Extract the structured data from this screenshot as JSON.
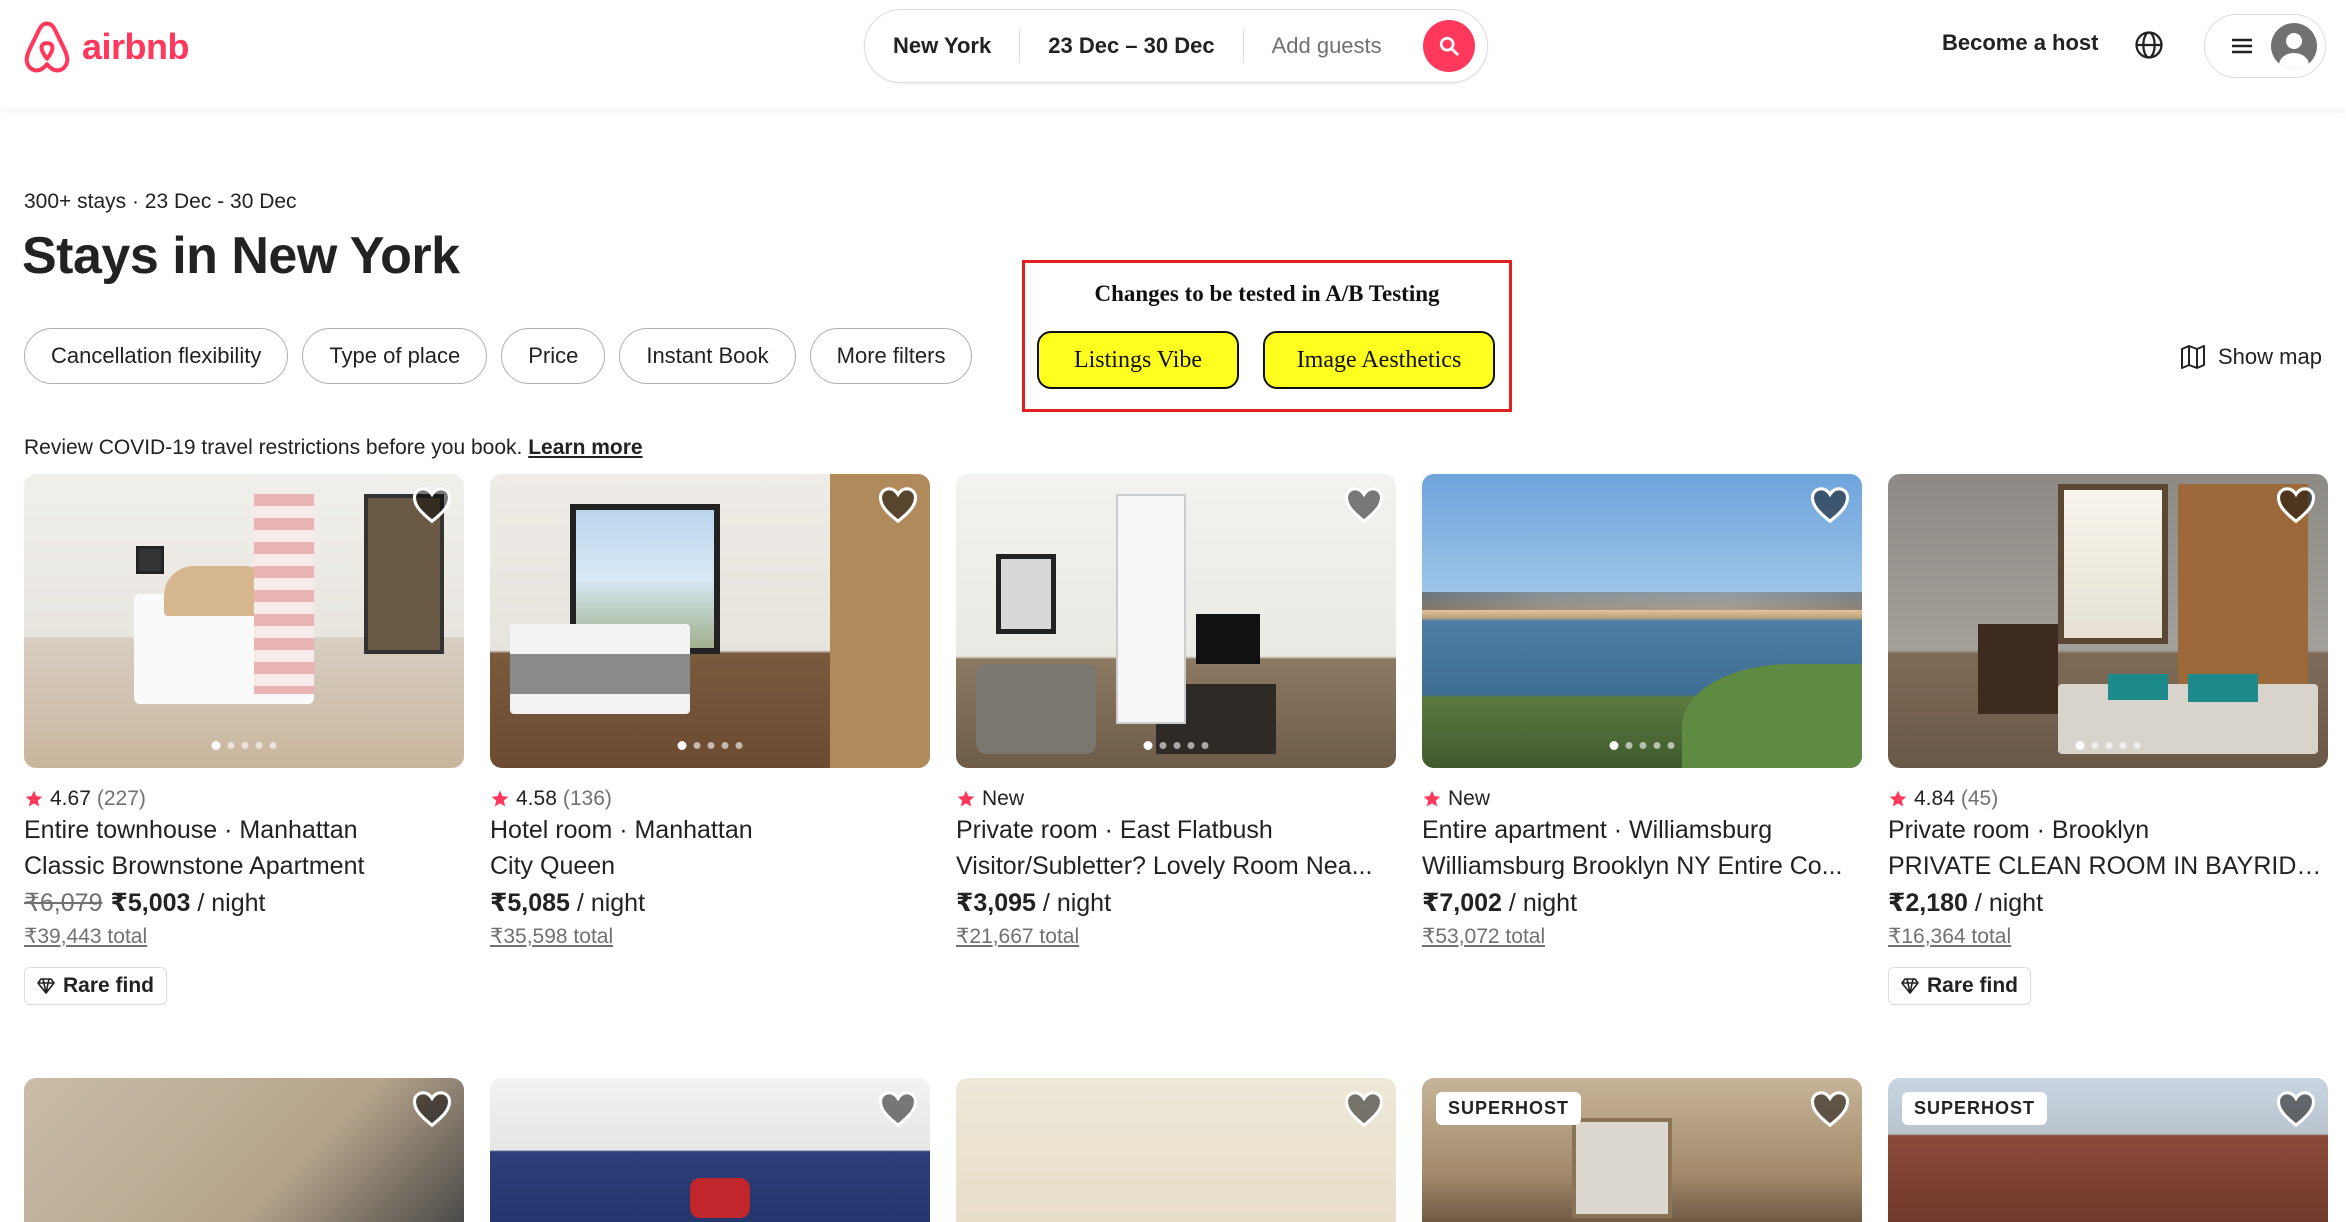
{
  "header": {
    "logo_text": "airbnb",
    "search": {
      "location": "New York",
      "dates": "23 Dec – 30 Dec",
      "guests_placeholder": "Add guests"
    },
    "become_host": "Become a host"
  },
  "page": {
    "meta": "300+ stays · 23 Dec - 30 Dec",
    "title": "Stays in New York"
  },
  "filters": [
    "Cancellation flexibility",
    "Type of place",
    "Price",
    "Instant Book",
    "More filters"
  ],
  "ab_test": {
    "title": "Changes to be tested in A/B Testing",
    "buttons": [
      "Listings Vibe",
      "Image Aesthetics"
    ]
  },
  "show_map": "Show map",
  "covid": {
    "text": "Review COVID-19 travel restrictions before you book.",
    "link": "Learn more"
  },
  "listings": [
    {
      "rating": "4.67",
      "count": "(227)",
      "type": "Entire townhouse · Manhattan",
      "name": "Classic Brownstone Apartment",
      "old_price": "₹6,079",
      "price": "₹5,003",
      "per": "/ night",
      "total": "₹39,443 total",
      "badge": "Rare find"
    },
    {
      "rating": "4.58",
      "count": "(136)",
      "type": "Hotel room · Manhattan",
      "name": "City Queen",
      "old_price": "",
      "price": "₹5,085",
      "per": "/ night",
      "total": "₹35,598 total",
      "badge": ""
    },
    {
      "rating": "New",
      "count": "",
      "type": "Private room · East Flatbush",
      "name": "Visitor/Subletter? Lovely Room Nea...",
      "old_price": "",
      "price": "₹3,095",
      "per": "/ night",
      "total": "₹21,667 total",
      "badge": ""
    },
    {
      "rating": "New",
      "count": "",
      "type": "Entire apartment · Williamsburg",
      "name": "Williamsburg Brooklyn NY Entire Co...",
      "old_price": "",
      "price": "₹7,002",
      "per": "/ night",
      "total": "₹53,072 total",
      "badge": ""
    },
    {
      "rating": "4.84",
      "count": "(45)",
      "type": "Private room · Brooklyn",
      "name": "PRIVATE CLEAN ROOM IN BAYRIDG...",
      "old_price": "",
      "price": "₹2,180",
      "per": "/ night",
      "total": "₹16,364 total",
      "badge": "Rare find"
    }
  ],
  "second_row": [
    {
      "badge": ""
    },
    {
      "badge": ""
    },
    {
      "badge": ""
    },
    {
      "badge": "SUPERHOST"
    },
    {
      "badge": "SUPERHOST"
    }
  ],
  "colors": {
    "brand": "#ff385c",
    "ab_highlight": "#ffff1f",
    "ab_border": "#e0201e"
  }
}
